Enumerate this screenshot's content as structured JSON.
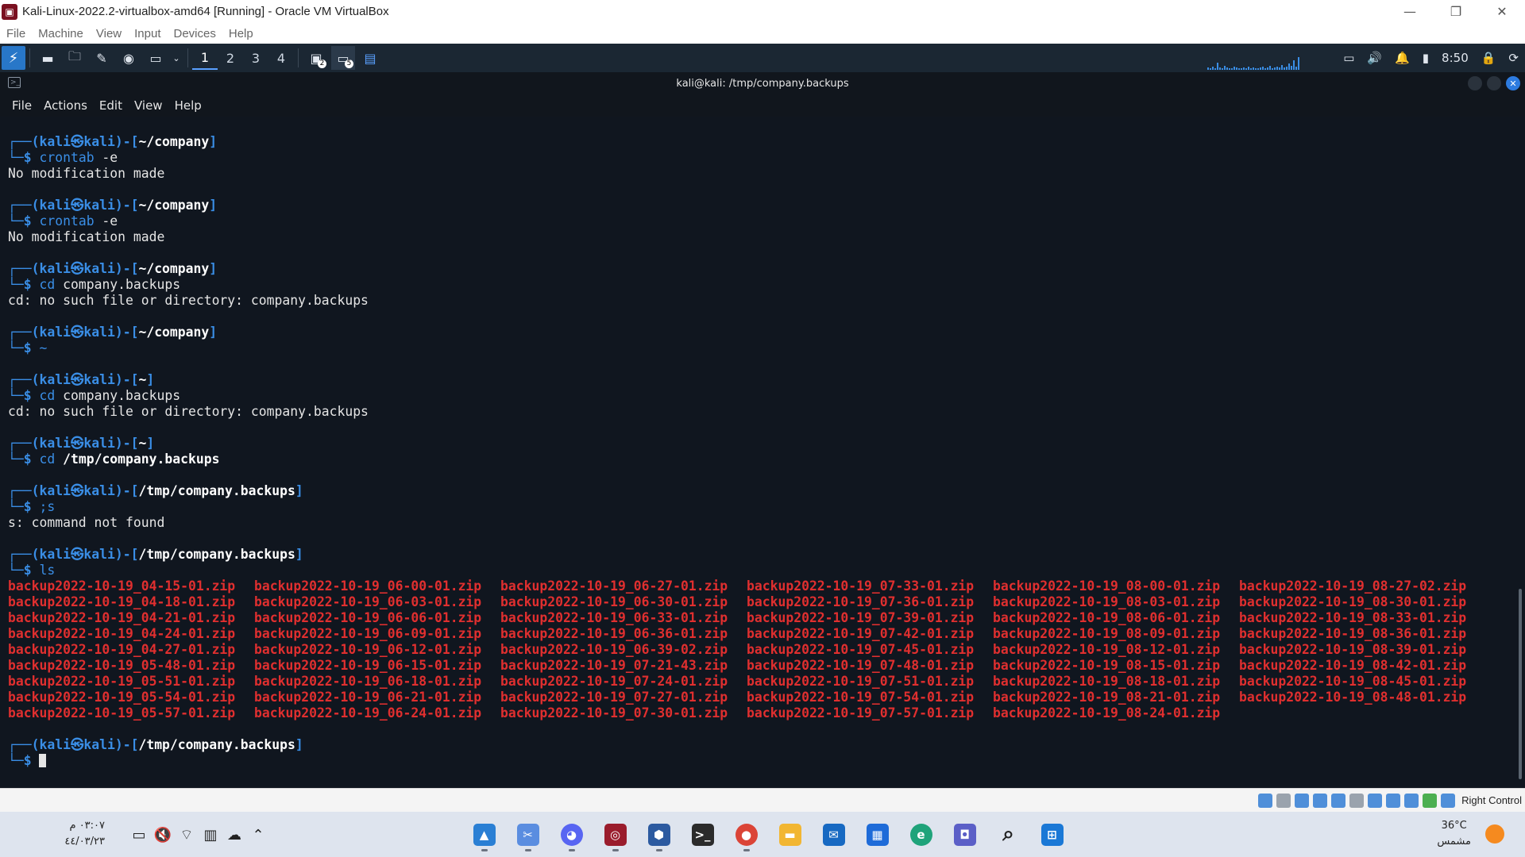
{
  "host": {
    "title": "Kali-Linux-2022.2-virtualbox-amd64 [Running] - Oracle VM VirtualBox",
    "menu": [
      "File",
      "Machine",
      "View",
      "Input",
      "Devices",
      "Help"
    ],
    "controls": {
      "minimize": "—",
      "restore": "❐",
      "close": "✕"
    }
  },
  "kali_panel": {
    "workspaces": [
      "1",
      "2",
      "3",
      "4"
    ],
    "clock": "8:50",
    "badges": {
      "a": "2",
      "b": "5"
    }
  },
  "terminal": {
    "title": "kali@kali: /tmp/company.backups",
    "menu": [
      "File",
      "Actions",
      "Edit",
      "View",
      "Help"
    ],
    "prompt": {
      "user": "kali",
      "at": "㉿",
      "host": "kali"
    },
    "blocks": [
      {
        "path": "~/company",
        "cmd": "crontab",
        "arg": " -e",
        "output": [
          "No modification made"
        ]
      },
      {
        "path": "~/company",
        "cmd": "crontab",
        "arg": " -e",
        "output": [
          "No modification made"
        ]
      },
      {
        "path": "~/company",
        "cmd": "cd",
        "arg": " company.backups",
        "output": [
          "cd: no such file or directory: company.backups"
        ]
      },
      {
        "path": "~/company",
        "cmd": "~",
        "arg": "",
        "output": []
      },
      {
        "path": "~",
        "cmd": "cd",
        "arg": " company.backups",
        "output": [
          "cd: no such file or directory: company.backups"
        ]
      },
      {
        "path": "~",
        "cmd": "cd",
        "arg": " /tmp/company.backups",
        "output": []
      },
      {
        "path": "/tmp/company.backups",
        "cmd": ";s",
        "arg": "",
        "output": [
          "s: command not found"
        ]
      },
      {
        "path": "/tmp/company.backups",
        "cmd": "ls",
        "arg": "",
        "output": []
      }
    ],
    "ls_columns": [
      [
        "backup2022-10-19_04-15-01.zip",
        "backup2022-10-19_04-18-01.zip",
        "backup2022-10-19_04-21-01.zip",
        "backup2022-10-19_04-24-01.zip",
        "backup2022-10-19_04-27-01.zip",
        "backup2022-10-19_05-48-01.zip",
        "backup2022-10-19_05-51-01.zip",
        "backup2022-10-19_05-54-01.zip",
        "backup2022-10-19_05-57-01.zip"
      ],
      [
        "backup2022-10-19_06-00-01.zip",
        "backup2022-10-19_06-03-01.zip",
        "backup2022-10-19_06-06-01.zip",
        "backup2022-10-19_06-09-01.zip",
        "backup2022-10-19_06-12-01.zip",
        "backup2022-10-19_06-15-01.zip",
        "backup2022-10-19_06-18-01.zip",
        "backup2022-10-19_06-21-01.zip",
        "backup2022-10-19_06-24-01.zip"
      ],
      [
        "backup2022-10-19_06-27-01.zip",
        "backup2022-10-19_06-30-01.zip",
        "backup2022-10-19_06-33-01.zip",
        "backup2022-10-19_06-36-01.zip",
        "backup2022-10-19_06-39-02.zip",
        "backup2022-10-19_07-21-43.zip",
        "backup2022-10-19_07-24-01.zip",
        "backup2022-10-19_07-27-01.zip",
        "backup2022-10-19_07-30-01.zip"
      ],
      [
        "backup2022-10-19_07-33-01.zip",
        "backup2022-10-19_07-36-01.zip",
        "backup2022-10-19_07-39-01.zip",
        "backup2022-10-19_07-42-01.zip",
        "backup2022-10-19_07-45-01.zip",
        "backup2022-10-19_07-48-01.zip",
        "backup2022-10-19_07-51-01.zip",
        "backup2022-10-19_07-54-01.zip",
        "backup2022-10-19_07-57-01.zip"
      ],
      [
        "backup2022-10-19_08-00-01.zip",
        "backup2022-10-19_08-03-01.zip",
        "backup2022-10-19_08-06-01.zip",
        "backup2022-10-19_08-09-01.zip",
        "backup2022-10-19_08-12-01.zip",
        "backup2022-10-19_08-15-01.zip",
        "backup2022-10-19_08-18-01.zip",
        "backup2022-10-19_08-21-01.zip",
        "backup2022-10-19_08-24-01.zip"
      ],
      [
        "backup2022-10-19_08-27-02.zip",
        "backup2022-10-19_08-30-01.zip",
        "backup2022-10-19_08-33-01.zip",
        "backup2022-10-19_08-36-01.zip",
        "backup2022-10-19_08-39-01.zip",
        "backup2022-10-19_08-42-01.zip",
        "backup2022-10-19_08-45-01.zip",
        "backup2022-10-19_08-48-01.zip"
      ]
    ],
    "final_prompt_path": "/tmp/company.backups",
    "colors": {
      "prompt": "#3a8ee6",
      "zip": "#e02f2f",
      "bg": "#10161f"
    }
  },
  "vbox_status": {
    "host_key": "Right Control"
  },
  "taskbar": {
    "time": "٠٣:٠٧ م",
    "date": "٤٤/٠٣/٢٣",
    "temperature": "36°C",
    "weather": "مشمس",
    "apps": [
      "photos-icon",
      "snipping-tool-icon",
      "discord-icon",
      "virtualbox-icon",
      "box-icon",
      "terminal-icon",
      "chrome-icon",
      "file-explorer-icon",
      "mail-icon",
      "store-icon",
      "edge-icon",
      "chat-icon",
      "search-icon",
      "start-icon"
    ]
  }
}
